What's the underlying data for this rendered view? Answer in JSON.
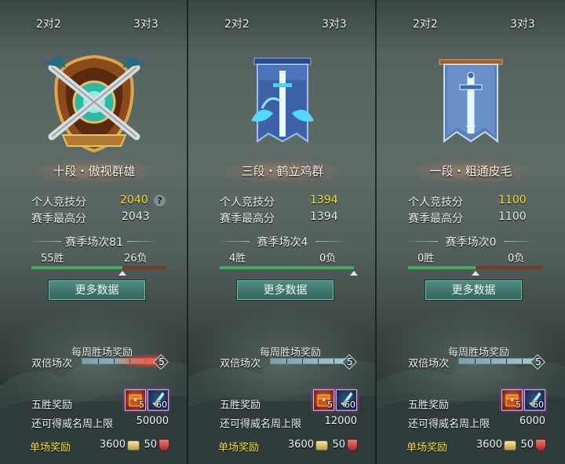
{
  "panels": [
    {
      "tabs": [
        "2对2",
        "3对3"
      ],
      "emblem": "crossed-swords-gold-shield-icon",
      "rank_title": "十段・傲视群雄",
      "personal_score_label": "个人竞技分",
      "personal_score": "2040",
      "help_icon": "?",
      "season_high_label": "赛季最高分",
      "season_high": "2043",
      "season_matches": "赛季场次81",
      "wins": "55胜",
      "losses": "26负",
      "win_ratio": 0.68,
      "more_data": "更多数据",
      "weekly_header": "每周胜场奖励",
      "double_label": "双倍场次",
      "double_count": "5",
      "double_progress": 1.0,
      "five_win_label": "五胜奖励",
      "reward_items": [
        {
          "icon": "treasure-chest-icon",
          "count": "5"
        },
        {
          "icon": "ice-sword-icon",
          "count": "60"
        }
      ],
      "limit_label": "还可得威名周上限",
      "limit_value": "50000",
      "single_label": "单场奖励",
      "coin_value": "3600",
      "honor_value": "50"
    },
    {
      "tabs": [
        "2对2",
        "3对3"
      ],
      "emblem": "crane-sword-banner-icon",
      "rank_title": "三段・鹤立鸡群",
      "personal_score_label": "个人竞技分",
      "personal_score": "1394",
      "season_high_label": "赛季最高分",
      "season_high": "1394",
      "season_matches": "赛季场次4",
      "wins": "4胜",
      "losses": "0负",
      "win_ratio": 1.0,
      "more_data": "更多数据",
      "weekly_header": "每周胜场奖励",
      "double_label": "双倍场次",
      "double_count": "5",
      "double_progress": 1.0,
      "five_win_label": "五胜奖励",
      "reward_items": [
        {
          "icon": "treasure-chest-icon",
          "count": "5"
        },
        {
          "icon": "ice-sword-icon",
          "count": "60"
        }
      ],
      "limit_label": "还可得威名周上限",
      "limit_value": "12000",
      "single_label": "单场奖励",
      "coin_value": "3600",
      "honor_value": "50"
    },
    {
      "tabs": [
        "2对2",
        "3对3"
      ],
      "emblem": "sword-banner-icon",
      "rank_title": "一段・粗通皮毛",
      "personal_score_label": "个人竞技分",
      "personal_score": "1100",
      "season_high_label": "赛季最高分",
      "season_high": "1100",
      "season_matches": "赛季场次0",
      "wins": "0胜",
      "losses": "0负",
      "win_ratio": 0.5,
      "more_data": "更多数据",
      "weekly_header": "每周胜场奖励",
      "double_label": "双倍场次",
      "double_count": "5",
      "double_progress": 1.0,
      "five_win_label": "五胜奖励",
      "reward_items": [
        {
          "icon": "treasure-chest-icon",
          "count": "5"
        },
        {
          "icon": "ice-sword-icon",
          "count": "60"
        }
      ],
      "limit_label": "还可得威名周上限",
      "limit_value": "6000",
      "single_label": "单场奖励",
      "coin_value": "3600",
      "honor_value": "50"
    }
  ],
  "colors": {
    "score_yellow": "#f2e230",
    "win_green": "#3fae5e",
    "loss_red": "#7a3a22",
    "button_teal": "#3e786f",
    "single_reward_yellow": "#f2e230"
  }
}
